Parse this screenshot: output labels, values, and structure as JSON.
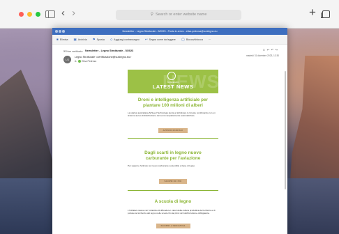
{
  "browser": {
    "address_placeholder": "Search or enter website name"
  },
  "mail": {
    "window_title": "Newsletter - Legno Strutturale - 5/2023 - Posta in arrivo - elisa.pedrosa@sunlegno.eu",
    "ribbon": [
      {
        "icon": "home-icon",
        "label": "Elimina"
      },
      {
        "icon": "archive-icon",
        "label": "Archivia"
      },
      {
        "icon": "flag-icon",
        "label": "Sposta"
      },
      {
        "icon": "tag-icon",
        "label": "Aggiungi contrassegno"
      },
      {
        "icon": "reply-icon",
        "label": "Segna come da leggere"
      },
      {
        "icon": "filter-icon",
        "label": "Blocca/sblocca"
      },
      {
        "icon": "more-icon",
        "label": "···"
      }
    ],
    "folder": "Non verificato",
    "subject": "Newsletter - Legno Strutturale - 5/2023",
    "avatar_initials": "LS",
    "sender": "Legno Strutturale <certificazione@sunlegno.eu>",
    "to_label": "A:",
    "to_name": "Elisa Pedrosa",
    "date": "martedì 31 dicembre 2023, 12:30"
  },
  "newsletter": {
    "logo_text": "SUNLEGNO",
    "banner_ghost": "NEWS",
    "banner_title": "LATEST NEWS",
    "articles": [
      {
        "title": "Droni e intelligenza artificiale per piantare 100 milioni di alberi",
        "body": "La startup australiana AirSeed Technology punta a ripristinare le foreste combinando con un sistema aereo di distribuzione dei semi completamente automatizzato.",
        "cta": "APPROFONDISCI"
      },
      {
        "title": "Dagli scarti in legno nuovo carburante per l'aviazione",
        "body": "Per saperne l'articolo sul nuovo carburante sostenibile a base di legno.",
        "cta": "SCOPRI DI PIÙ"
      },
      {
        "title": "A scuola di legno",
        "body": "L'iniziativa nasce con l'obiettivo di diffondere i valori della cultura produttiva del territorio e di portare la ricchezza del legno nelle scuole fin dai primi cicli dell'istruzione obbligatoria.",
        "cta": "SCOPRI L'INIZIATIVA"
      }
    ]
  },
  "colors": {
    "accent_green": "#8bb534",
    "banner_green": "#9cc146",
    "title_bar_blue": "#3d6ebf",
    "cta_tan": "#d9b58a"
  }
}
